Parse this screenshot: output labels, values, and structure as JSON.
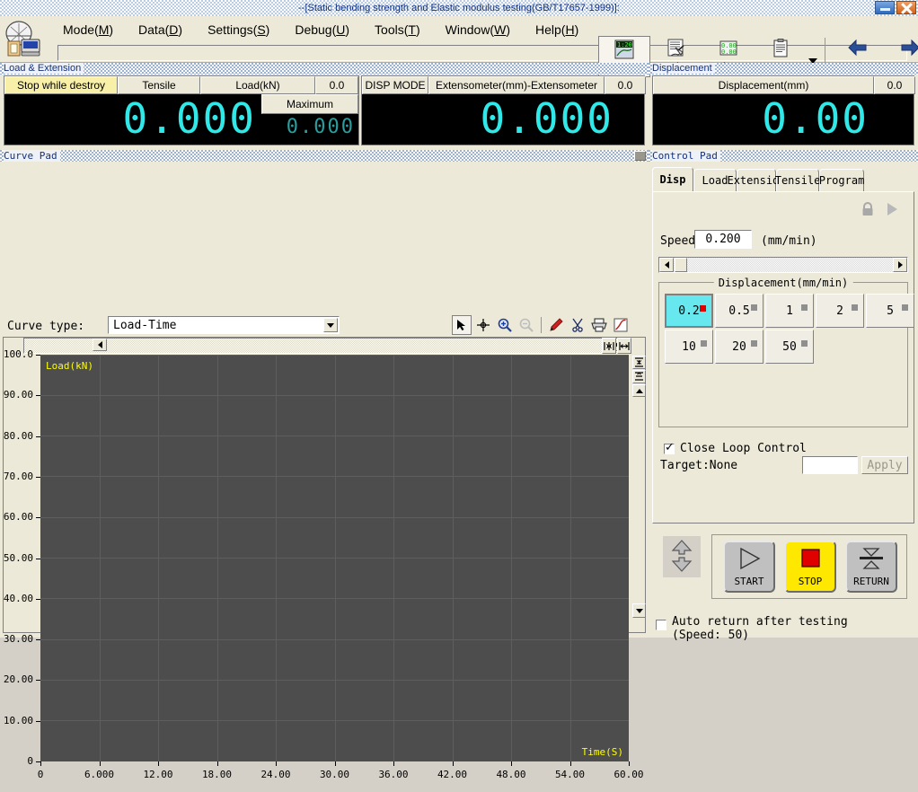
{
  "window": {
    "title": "--[Static bending strength and Elastic modulus testing(GB/T17657-1999)]:",
    "minimize_icon": "minimize-icon",
    "close_icon": "close-icon"
  },
  "menu": {
    "items": [
      {
        "label": "Mode",
        "mnemonic": "M"
      },
      {
        "label": "Data",
        "mnemonic": "D"
      },
      {
        "label": "Settings",
        "mnemonic": "S"
      },
      {
        "label": "Debug",
        "mnemonic": "U"
      },
      {
        "label": "Tools",
        "mnemonic": "T"
      },
      {
        "label": "Window",
        "mnemonic": "W"
      },
      {
        "label": "Help",
        "mnemonic": "H"
      }
    ]
  },
  "toolbar": {
    "buttons": [
      {
        "label": "Test",
        "icon": "test-chart-icon",
        "selected": true
      },
      {
        "label": "Analyse",
        "icon": "analyse-report-icon",
        "selected": false
      },
      {
        "label": "Clear",
        "icon": "clear-digits-icon",
        "selected": false
      },
      {
        "label": "Data",
        "icon": "data-clipboard-icon",
        "selected": false
      }
    ],
    "dropdown_icon": "chevron-down-icon",
    "nav": [
      {
        "label": "Previous",
        "icon": "arrow-left-icon"
      },
      {
        "label": "Next",
        "icon": "arrow-right-icon"
      }
    ]
  },
  "load_extension": {
    "caption": "Load & Extension",
    "left": {
      "mode_button": "Stop while destroy",
      "direction_button": "Tensile",
      "unit_button": "Load(kN)",
      "rate_value": "0.0",
      "reading": "0.000",
      "maximum_label": "Maximum",
      "maximum_value": "0.000"
    },
    "right": {
      "mode_button": "DISP MODE",
      "channel_button": "Extensometer(mm)-Extensometer",
      "rate_value": "0.0",
      "reading": "0.000"
    }
  },
  "displacement": {
    "caption": "Displacement",
    "unit_button": "Displacement(mm)",
    "rate_value": "0.0",
    "reading": "0.00"
  },
  "curve_pad": {
    "caption": "Curve Pad",
    "curve_type_label": "Curve type:",
    "curve_type_value": "Load-Time",
    "tools": [
      {
        "icon": "select-arrow-icon",
        "active": true,
        "enabled": true
      },
      {
        "icon": "crosshair-icon",
        "active": false,
        "enabled": true
      },
      {
        "icon": "zoom-in-icon",
        "active": false,
        "enabled": true
      },
      {
        "icon": "zoom-out-icon",
        "active": false,
        "enabled": false
      },
      {
        "icon": "pen-marker-icon",
        "active": false,
        "enabled": true
      },
      {
        "icon": "scissors-icon",
        "active": false,
        "enabled": true
      },
      {
        "icon": "printer-icon",
        "active": false,
        "enabled": true
      },
      {
        "icon": "curve-graph-icon",
        "active": false,
        "enabled": true
      }
    ],
    "scroll": {
      "left_arrow": "scroll-left-icon",
      "right_arrow": "scroll-right-icon",
      "fit_x_icon": "fit-horizontal-icon",
      "expand_x_icon": "expand-horizontal-icon",
      "fit_y_icon": "fit-vertical-icon",
      "expand_y_icon": "expand-vertical-icon",
      "up_arrow": "scroll-up-icon",
      "down_arrow": "scroll-down-icon"
    }
  },
  "chart_data": {
    "type": "line",
    "title": "",
    "xlabel": "Time(S)",
    "ylabel": "Load(kN)",
    "xlim": [
      0,
      60
    ],
    "ylim": [
      0,
      100
    ],
    "xticks": [
      "0",
      "6.000",
      "12.00",
      "18.00",
      "24.00",
      "30.00",
      "36.00",
      "42.00",
      "48.00",
      "54.00",
      "60.00"
    ],
    "yticks": [
      "0",
      "10.00",
      "20.00",
      "30.00",
      "40.00",
      "50.00",
      "60.00",
      "70.00",
      "80.00",
      "90.00",
      "100.0"
    ],
    "grid": true,
    "series": [
      {
        "name": "Load-Time",
        "x": [],
        "y": []
      }
    ],
    "plot_background": "#4d4d4d",
    "axis_label_color": "#ffff00"
  },
  "control_pad": {
    "caption": "Control Pad",
    "tabs": [
      {
        "label": "Disp",
        "selected": true
      },
      {
        "label": "Load",
        "selected": false
      },
      {
        "label": "Extension",
        "selected": false
      },
      {
        "label": "Tensile",
        "selected": false
      },
      {
        "label": "Program",
        "selected": false
      }
    ],
    "lock_icon": "lock-icon",
    "play_icon": "play-arrow-icon",
    "speed_label": "Speed",
    "speed_value": "0.200",
    "speed_unit": "(mm/min)",
    "slider": {
      "left_arrow": "slider-left-icon",
      "right_arrow": "slider-right-icon"
    },
    "speed_group_legend": "Displacement(mm/min)",
    "speed_buttons": [
      {
        "label": "0.2",
        "selected": true
      },
      {
        "label": "0.5",
        "selected": false
      },
      {
        "label": "1",
        "selected": false
      },
      {
        "label": "2",
        "selected": false
      },
      {
        "label": "5",
        "selected": false
      },
      {
        "label": "10",
        "selected": false
      },
      {
        "label": "20",
        "selected": false
      },
      {
        "label": "50",
        "selected": false
      }
    ],
    "close_loop": {
      "label": "Close Loop Control",
      "checked": true,
      "target_label": "Target:None",
      "target_value": "",
      "apply_label": "Apply"
    },
    "jog_icon": "jog-updown-icon",
    "actions": [
      {
        "label": "START",
        "icon": "play-triangle-icon",
        "color": "#c0c0c0"
      },
      {
        "label": "STOP",
        "icon": "stop-square-icon",
        "color": "#ffe800"
      },
      {
        "label": "RETURN",
        "icon": "return-arrows-icon",
        "color": "#c0c0c0"
      }
    ],
    "auto_return": {
      "line1": "Auto return after testing",
      "line2": "(Speed: 50)",
      "checked": false
    }
  },
  "colors": {
    "accent_lcd": "#30e8e8",
    "highlight": "#66e8ee",
    "stop": "#e00000",
    "caption_text": "#11307d",
    "warning_cell": "#f8f0a8"
  }
}
